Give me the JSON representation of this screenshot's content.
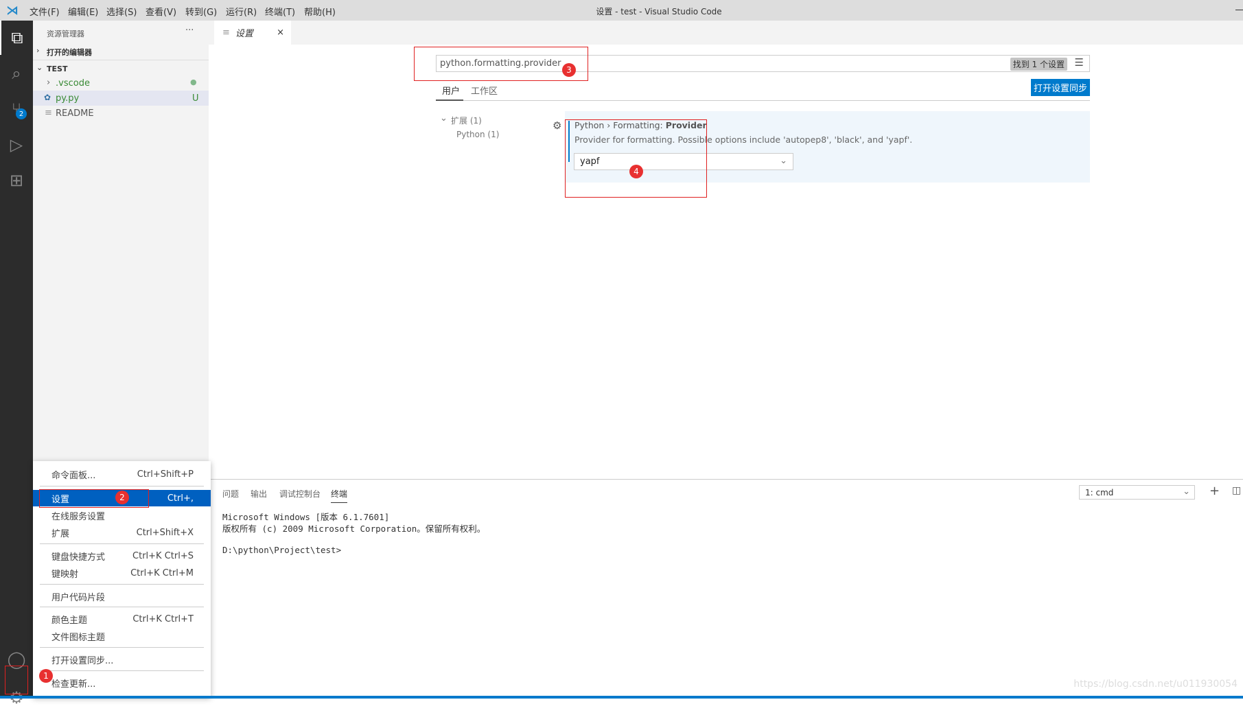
{
  "window": {
    "title": "设置 - test - Visual Studio Code"
  },
  "menubar": [
    "文件(F)",
    "编辑(E)",
    "选择(S)",
    "查看(V)",
    "转到(G)",
    "运行(R)",
    "终端(T)",
    "帮助(H)"
  ],
  "activity": {
    "scm_badge": "2"
  },
  "sidebar": {
    "title": "资源管理器",
    "more": "···",
    "open_editors": "打开的编辑器",
    "folder": "TEST",
    "items": [
      {
        "label": ".vscode",
        "status": "●"
      },
      {
        "label": "py.py",
        "status": "U"
      },
      {
        "label": "README",
        "status": ""
      }
    ]
  },
  "tab": {
    "label": "设置",
    "close": "×"
  },
  "settings": {
    "search_value": "python.formatting.provider",
    "found": "找到 1 个设置",
    "scope_tabs": [
      "用户",
      "工作区"
    ],
    "sync_button": "打开设置同步",
    "tree": {
      "group": "扩展 (1)",
      "child": "Python (1)"
    },
    "item": {
      "title_prefix": "Python › Formatting: ",
      "title_bold": "Provider",
      "description": "Provider for formatting. Possible options include 'autopep8', 'black', and 'yapf'.",
      "value": "yapf"
    }
  },
  "panel": {
    "tabs": [
      "问题",
      "输出",
      "调试控制台",
      "终端"
    ],
    "terminal_select": "1: cmd",
    "lines": [
      "Microsoft Windows [版本 6.1.7601]",
      "版权所有 (c) 2009 Microsoft Corporation。保留所有权利。",
      "",
      "D:\\python\\Project\\test>"
    ]
  },
  "context_menu": [
    {
      "label": "命令面板...",
      "shortcut": "Ctrl+Shift+P"
    },
    {
      "label": "设置",
      "shortcut": "Ctrl+,"
    },
    {
      "label": "在线服务设置",
      "shortcut": ""
    },
    {
      "label": "扩展",
      "shortcut": "Ctrl+Shift+X"
    },
    {
      "label": "键盘快捷方式",
      "shortcut": "Ctrl+K Ctrl+S"
    },
    {
      "label": "键映射",
      "shortcut": "Ctrl+K Ctrl+M"
    },
    {
      "label": "用户代码片段",
      "shortcut": ""
    },
    {
      "label": "颜色主题",
      "shortcut": "Ctrl+K Ctrl+T"
    },
    {
      "label": "文件图标主题",
      "shortcut": ""
    },
    {
      "label": "打开设置同步...",
      "shortcut": ""
    },
    {
      "label": "检查更新...",
      "shortcut": ""
    }
  ],
  "annotations": [
    "1",
    "2",
    "3",
    "4"
  ],
  "watermark": "https://blog.csdn.net/u011930054",
  "colors": {
    "accent": "#007acc",
    "highlight": "#0060c0",
    "annotation": "#e83030"
  }
}
